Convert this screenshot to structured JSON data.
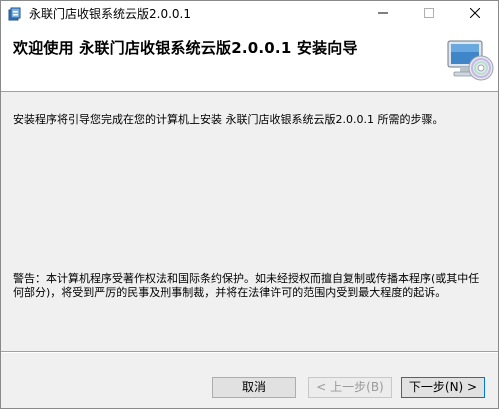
{
  "window": {
    "title": "永联门店收银系统云版2.0.0.1"
  },
  "header": {
    "title": "欢迎使用 永联门店收银系统云版2.0.0.1 安装向导"
  },
  "content": {
    "intro": "安装程序将引导您完成在您的计算机上安装 永联门店收银系统云版2.0.0.1 所需的步骤。",
    "warning": "警告：本计算机程序受著作权法和国际条约保护。如未经授权而擅自复制或传播本程序(或其中任何部分)，将受到严厉的民事及刑事制裁，并将在法律许可的范围内受到最大程度的起诉。"
  },
  "buttons": {
    "cancel": "取消",
    "back": "< 上一步(B)",
    "next": "下一步(N) >"
  },
  "icons": {
    "app": "installer-box-icon",
    "header": "computer-disc-icon",
    "minimize": "minimize-icon",
    "maximize": "maximize-icon",
    "close": "close-icon"
  },
  "colors": {
    "accent": "#0078d7",
    "disabled_text": "#9a9a9a"
  }
}
